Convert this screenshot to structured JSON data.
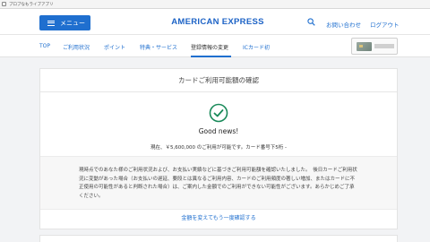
{
  "browser": {
    "tab_title": "プロプなもライブアプリ"
  },
  "header": {
    "menu_label": "メニュー",
    "logo_text": "AMERICAN EXPRESS",
    "contact_label": "お問い合わせ",
    "logout_label": "ログアウト"
  },
  "nav": {
    "items": [
      {
        "label": "TOP"
      },
      {
        "label": "ご利用状況"
      },
      {
        "label": "ポイント"
      },
      {
        "label": "特典・サービス"
      },
      {
        "label": "登録情報の変更"
      },
      {
        "label": "ICカード初"
      }
    ],
    "active_index": 4
  },
  "panel": {
    "title": "カードご利用可能額の確認",
    "headline": "Good news!",
    "status": "現在、￥5,600,000 のご利用が可能です。カード番号下5桁 -",
    "notice": "現時点でのあなた様のご利用状況および、お支払い実績などに基づきご利用可能額を確認いたしました。　後日カードご利用状況に変動があった場合（お支払いの遅延、要段とは異なるご利用内容、カードのご利用頻度の著しい増加、またはカードに不正使用の可能性があると判断された場合）は、ご案内した金額でのご利用ができない可能性がございます。あらかじめご了承ください。",
    "change_link": "金額を変えてもう一度確認する"
  },
  "colors": {
    "brand_blue": "#1f6fcf",
    "check_green": "#1a8a5a"
  }
}
